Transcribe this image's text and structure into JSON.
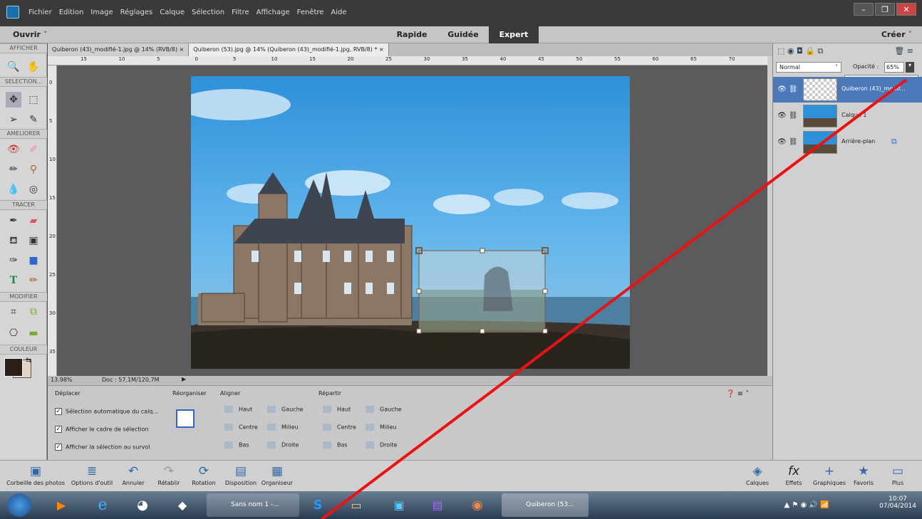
{
  "menu": {
    "items": [
      "Fichier",
      "Edition",
      "Image",
      "Réglages",
      "Calque",
      "Sélection",
      "Filtre",
      "Affichage",
      "Fenêtre",
      "Aide"
    ]
  },
  "modebar": {
    "open": "Ouvrir",
    "modes": [
      "Rapide",
      "Guidée",
      "Expert"
    ],
    "active_mode": "Expert",
    "create": "Créer"
  },
  "toolbox": {
    "sections": [
      "AFFICHER",
      "SELECTION...",
      "AMELIORER",
      "TRACER",
      "MODIFIER",
      "COULEUR"
    ]
  },
  "tabs": [
    {
      "label": "Quiberon (43)_modifié-1.jpg @ 14% (RVB/8)",
      "close": "×"
    },
    {
      "label": "Quiberon (53).jpg @ 14% (Quiberon (43)_modifié-1.jpg, RVB/8) *",
      "close": "×"
    }
  ],
  "ruler_top": [
    "15",
    "10",
    "5",
    "0",
    "5",
    "10",
    "15",
    "20",
    "25",
    "30",
    "35",
    "40",
    "45",
    "50",
    "55",
    "60",
    "65",
    "70"
  ],
  "ruler_left": [
    "0",
    "5",
    "10",
    "15",
    "20",
    "25",
    "30",
    "35",
    "40",
    "45"
  ],
  "status": {
    "zoom": "13.98%",
    "doc": "Doc : 57,1M/120,7M"
  },
  "options": {
    "deplacer": "Déplacer",
    "checks": [
      "Sélection automatique du calq...",
      "Afficher le cadre de sélection",
      "Afficher la sélection au survol"
    ],
    "reorganiser": "Réorganiser",
    "aligner": "Aligner",
    "align_items": [
      [
        "Haut",
        "Gauche"
      ],
      [
        "Centre",
        "Milieu"
      ],
      [
        "Bas",
        "Droite"
      ]
    ],
    "repartir": "Répartir",
    "repartir_items": [
      [
        "Haut",
        "Gauche"
      ],
      [
        "Centre",
        "Milieu"
      ],
      [
        "Bas",
        "Droite"
      ]
    ]
  },
  "layers": {
    "blend_mode": "Normal",
    "opacity_label": "Opacité :",
    "opacity_value": "65%",
    "opacity": 0.65,
    "items": [
      {
        "name": "Quiberon (43)_modif...",
        "selected": true
      },
      {
        "name": "Calque 1",
        "selected": false
      },
      {
        "name": "Arrière-plan",
        "selected": false
      }
    ]
  },
  "bottombar": {
    "left": [
      "Corbeille des photos",
      "Options d'outil",
      "Annuler",
      "Rétablir",
      "Rotation",
      "Disposition",
      "Organiseur"
    ],
    "right": [
      "Calques",
      "Effets",
      "Graphiques",
      "Favoris",
      "Plus"
    ]
  },
  "taskbar": {
    "apps": [
      "Sans nom 1 -...",
      "Quiberon (53..."
    ],
    "time": "10:07",
    "date": "07/04/2014"
  },
  "colors": {
    "accent": "#1e1e1e",
    "selection": "#4a78b8",
    "annotation_line": "#ee1111"
  }
}
